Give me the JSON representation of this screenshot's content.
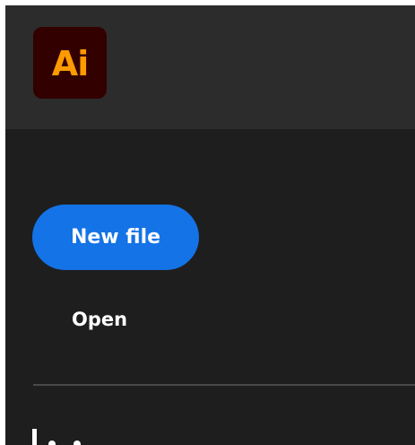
{
  "app": {
    "logo_text": "Ai",
    "logo_bg_color": "#330000",
    "logo_text_color": "#ff9a00"
  },
  "actions": {
    "new_file_label": "New file",
    "open_label": "Open"
  },
  "colors": {
    "accent": "#1473e6",
    "background": "#1e1e1e",
    "header_background": "#2c2c2c"
  }
}
